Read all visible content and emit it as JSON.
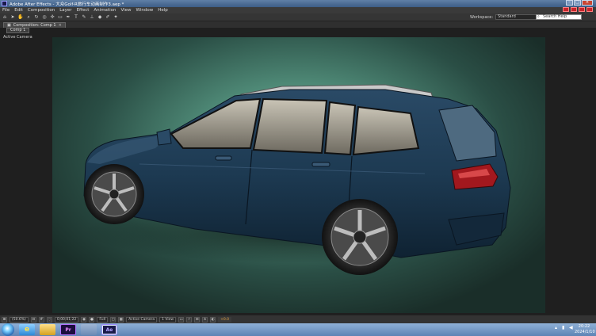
{
  "window": {
    "title": "Adobe After Effects - 大众Golf-R旅行车动画制作3.aep *",
    "controls": [
      "minimize",
      "maximize",
      "close"
    ]
  },
  "menu": {
    "items": [
      "File",
      "Edit",
      "Composition",
      "Layer",
      "Effect",
      "Animation",
      "View",
      "Window",
      "Help"
    ]
  },
  "toolbar": {
    "tools": [
      "home-tool",
      "hand-tool",
      "zoom-tool",
      "rotate-tool",
      "camera-tool",
      "pan-behind-tool",
      "mask-tool",
      "pen-tool",
      "type-tool",
      "brush-tool",
      "clone-tool",
      "eraser-tool",
      "roto-tool",
      "puppet-tool"
    ],
    "workspace_label": "Workspace:",
    "workspace_value": "Standard",
    "search_placeholder": "Search Help"
  },
  "panel": {
    "tab_label": "Composition: Comp 1",
    "comp_tab": "Comp 1",
    "view_label": "Active Camera"
  },
  "viewer_bar": {
    "zoom": "(50.6%)",
    "timecode": "0;00;01;22",
    "resolution": "Full",
    "camera": "Active Camera",
    "views": "1 View",
    "exposure": "+0.0"
  },
  "taskbar": {
    "apps": [
      "ie",
      "folder",
      "Pr",
      "ps",
      "Ae"
    ],
    "clock_time": "20:22",
    "clock_date": "2024/1/10"
  },
  "colors": {
    "car_body": "#1d3a52",
    "background_center": "#7cb9a3",
    "background_edge": "#1a2e29"
  }
}
